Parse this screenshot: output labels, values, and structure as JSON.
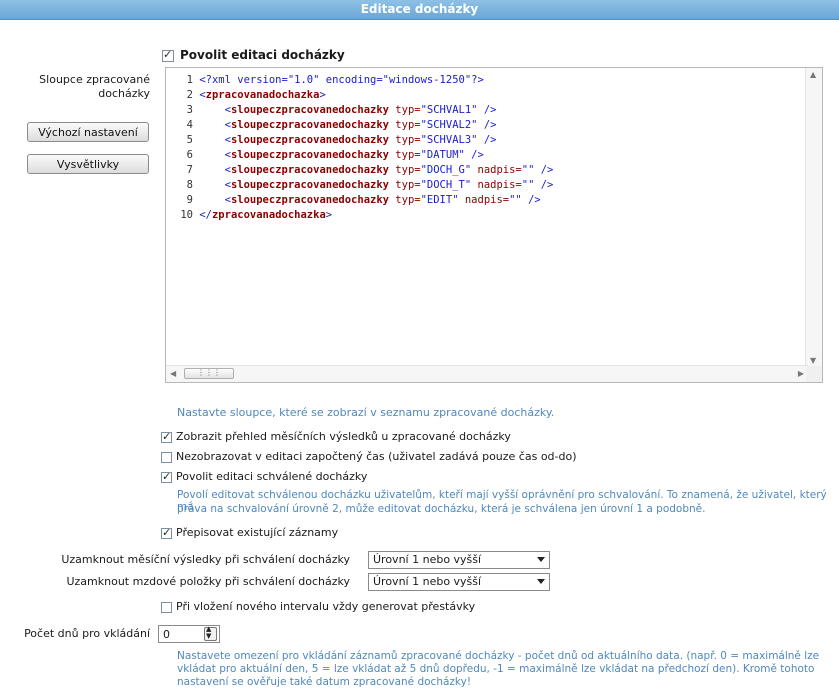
{
  "header": {
    "title": "Editace docházky"
  },
  "enable_edit": {
    "label": "Povolit editaci docházky",
    "checked": true
  },
  "left": {
    "columns_label_line1": "Sloupce zpracované",
    "columns_label_line2": "docházky",
    "default_button": "Výchozí nastavení",
    "help_button": "Vysvětlivky"
  },
  "editor": {
    "lines": [
      {
        "n": "1",
        "parts": [
          {
            "c": "txt",
            "t": "<?xml version=\"1.0\" encoding=\"windows-1250\"?>"
          }
        ]
      },
      {
        "n": "2",
        "parts": [
          {
            "c": "tag",
            "t": "<"
          },
          {
            "c": "tname",
            "t": "zpracovanadochazka"
          },
          {
            "c": "tag",
            "t": ">"
          }
        ]
      },
      {
        "n": "3",
        "parts": [
          {
            "c": "tag",
            "t": "    <"
          },
          {
            "c": "tname",
            "t": "sloupeczpracovanedochazky"
          },
          {
            "c": "attr",
            "t": " typ="
          },
          {
            "c": "val",
            "t": "\"SCHVAL1\""
          },
          {
            "c": "tag",
            "t": " />"
          }
        ]
      },
      {
        "n": "4",
        "parts": [
          {
            "c": "tag",
            "t": "    <"
          },
          {
            "c": "tname",
            "t": "sloupeczpracovanedochazky"
          },
          {
            "c": "attr",
            "t": " typ="
          },
          {
            "c": "val",
            "t": "\"SCHVAL2\""
          },
          {
            "c": "tag",
            "t": " />"
          }
        ]
      },
      {
        "n": "5",
        "parts": [
          {
            "c": "tag",
            "t": "    <"
          },
          {
            "c": "tname",
            "t": "sloupeczpracovanedochazky"
          },
          {
            "c": "attr",
            "t": " typ="
          },
          {
            "c": "val",
            "t": "\"SCHVAL3\""
          },
          {
            "c": "tag",
            "t": " />"
          }
        ]
      },
      {
        "n": "6",
        "parts": [
          {
            "c": "tag",
            "t": "    <"
          },
          {
            "c": "tname",
            "t": "sloupeczpracovanedochazky"
          },
          {
            "c": "attr",
            "t": " typ="
          },
          {
            "c": "val",
            "t": "\"DATUM\""
          },
          {
            "c": "tag",
            "t": " />"
          }
        ]
      },
      {
        "n": "7",
        "parts": [
          {
            "c": "tag",
            "t": "    <"
          },
          {
            "c": "tname",
            "t": "sloupeczpracovanedochazky"
          },
          {
            "c": "attr",
            "t": " typ="
          },
          {
            "c": "val",
            "t": "\"DOCH_G\""
          },
          {
            "c": "attr",
            "t": " nadpis="
          },
          {
            "c": "val",
            "t": "\"\""
          },
          {
            "c": "tag",
            "t": " />"
          }
        ]
      },
      {
        "n": "8",
        "parts": [
          {
            "c": "tag",
            "t": "    <"
          },
          {
            "c": "tname",
            "t": "sloupeczpracovanedochazky"
          },
          {
            "c": "attr",
            "t": " typ="
          },
          {
            "c": "val",
            "t": "\"DOCH_T\""
          },
          {
            "c": "attr",
            "t": " nadpis="
          },
          {
            "c": "val",
            "t": "\"\""
          },
          {
            "c": "tag",
            "t": " />"
          }
        ]
      },
      {
        "n": "9",
        "parts": [
          {
            "c": "tag",
            "t": "    <"
          },
          {
            "c": "tname",
            "t": "sloupeczpracovanedochazky"
          },
          {
            "c": "attr",
            "t": " typ="
          },
          {
            "c": "val",
            "t": "\"EDIT\""
          },
          {
            "c": "attr",
            "t": " nadpis="
          },
          {
            "c": "val",
            "t": "\"\""
          },
          {
            "c": "tag",
            "t": " />"
          }
        ]
      },
      {
        "n": "10",
        "parts": [
          {
            "c": "tag",
            "t": "</"
          },
          {
            "c": "tname",
            "t": "zpracovanadochazka"
          },
          {
            "c": "tag",
            "t": ">"
          }
        ]
      }
    ]
  },
  "hints": {
    "columns": "Nastavte sloupce, které se zobrazí v seznamu zpracované docházky.",
    "approved_line1": "Povolí editovat schválenou docházku uživatelům, kteří mají vyšší oprávnění pro schvalování. To znamená, že uživatel, který má",
    "approved_line2": "práva na schvalování úrovně 2, může editovat docházku, která je schválena jen úrovní 1 a podobně.",
    "days_line1": "Nastavete omezení pro vkládání záznamů zpracované docházky - počet dnů od aktuálního data. (např. 0 = maximálně lze",
    "days_line2": "vkládat pro aktuální den, 5 = lze vkládat až 5 dnů dopředu, -1 = maximálně lze vkládat na předchozí den). Kromě tohoto",
    "days_line3": "nastavení se ověřuje také datum zpracované docházky!"
  },
  "options": {
    "show_monthly": {
      "label": "Zobrazit přehled měsíčních výsledků u zpracované docházky",
      "checked": true
    },
    "hide_counted": {
      "label": "Nezobrazovat v editaci započtený čas (uživatel zadává pouze čas od-do)",
      "checked": false
    },
    "allow_approved": {
      "label": "Povolit editaci schválené docházky",
      "checked": true
    },
    "overwrite": {
      "label": "Přepisovat existující záznamy",
      "checked": true
    },
    "generate_breaks": {
      "label": "Při vložení nového intervalu vždy generovat přestávky",
      "checked": false
    }
  },
  "locks": {
    "monthly_label": "Uzamknout měsíční výsledky při schválení docházky",
    "monthly_value": "Úrovní 1 nebo vyšší",
    "payroll_label": "Uzamknout mzdové položky při schválení docházky",
    "payroll_value": "Úrovní 1 nebo vyšší"
  },
  "days": {
    "label": "Počet dnů pro vkládání",
    "value": "0"
  }
}
